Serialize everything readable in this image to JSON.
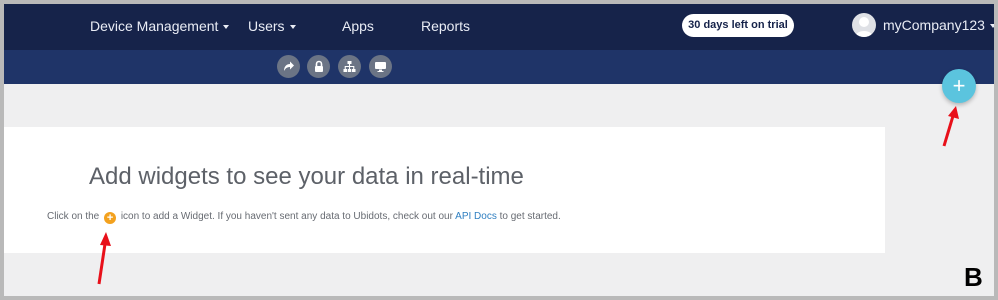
{
  "nav": {
    "device_management": "Device Management",
    "users": "Users",
    "apps": "Apps",
    "reports": "Reports"
  },
  "trial_badge": "30 days left on trial",
  "account": {
    "name": "myCompany123"
  },
  "toolbar": {
    "icons": [
      "share-icon",
      "lock-icon",
      "hierarchy-icon",
      "monitor-icon"
    ]
  },
  "fab": {
    "label": "+"
  },
  "empty_state": {
    "title": "Add widgets to see your data in real-time",
    "text_before": "Click on the",
    "text_middle": "icon to add a Widget. If you haven't sent any data to Ubidots, check out our",
    "link": "API Docs",
    "text_after": "to get started."
  },
  "annotation_letter": "B",
  "colors": {
    "topbar": "#16234a",
    "subbar": "#1f3468",
    "fab": "#5bc4de",
    "inline_plus": "#f3a11e",
    "arrow": "#e8101a",
    "link": "#2f7fc1"
  }
}
